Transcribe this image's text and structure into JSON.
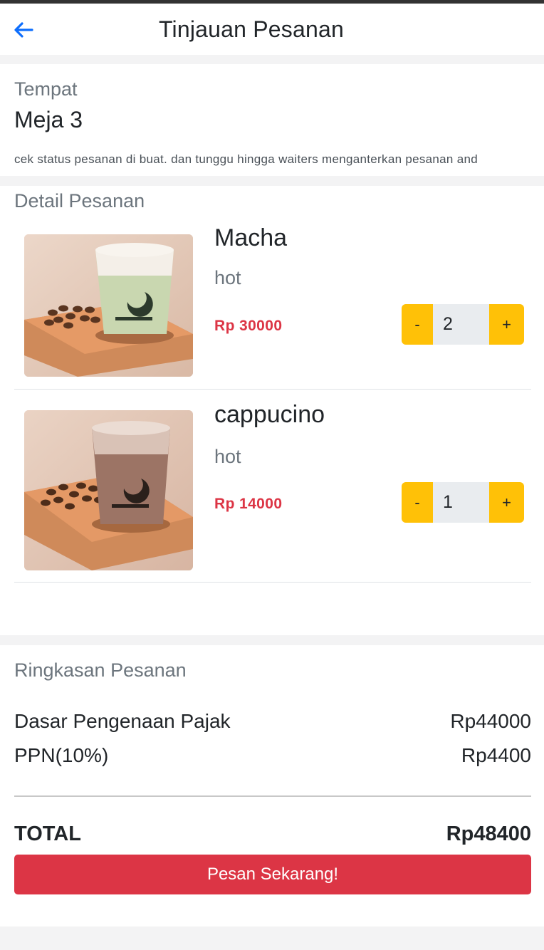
{
  "header": {
    "title": "Tinjauan Pesanan",
    "back_icon": "arrow-left-icon"
  },
  "tempat": {
    "label": "Tempat",
    "table": "Meja 3",
    "note": "cek status pesanan di buat. dan tunggu hingga waiters menganterkan pesanan and"
  },
  "detail": {
    "label": "Detail Pesanan",
    "items": [
      {
        "name": "Macha",
        "variant": "hot",
        "price": "Rp 30000",
        "qty": "2",
        "minus": "-",
        "plus": "+"
      },
      {
        "name": "cappucino",
        "variant": "hot",
        "price": "Rp 14000",
        "qty": "1",
        "minus": "-",
        "plus": "+"
      }
    ]
  },
  "summary": {
    "label": "Ringkasan Pesanan",
    "dpp_label": "Dasar Pengenaan Pajak",
    "dpp_value": "Rp44000",
    "ppn_label": "PPN(10%)",
    "ppn_value": "Rp4400",
    "total_label": "TOTAL",
    "total_value": "Rp48400",
    "order_button": "Pesan Sekarang!"
  },
  "colors": {
    "accent_blue": "#0d6efd",
    "price_red": "#dc3545",
    "stepper_yellow": "#ffc107",
    "button_red": "#dc3545"
  }
}
